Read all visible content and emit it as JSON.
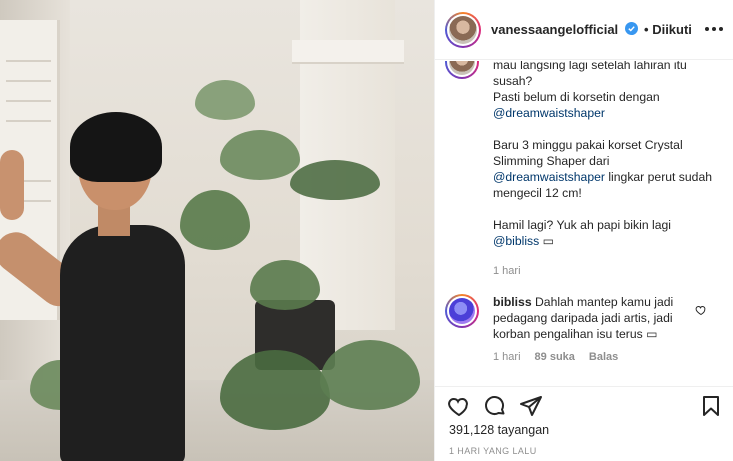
{
  "post": {
    "username": "vanessaangelofficial",
    "follow_separator": "•",
    "follow_status": "Diikuti",
    "caption": {
      "line1": "mau langsing lagi setelah lahiran itu susah?",
      "line2a": "Pasti belum di korsetin dengan",
      "mention1": "@dreamwaistshaper",
      "line3a": "Baru 3 minggu pakai korset Crystal Slimming Shaper dari",
      "mention2": "@dreamwaistshaper",
      "line3b": "lingkar perut sudah mengecil 12 cm!",
      "line4a": "Hamil lagi? Yuk ah papi bikin lagi",
      "mention3": "@bibliss",
      "emoji_placeholder": "▭",
      "time": "1 hari"
    },
    "comment": {
      "username": "bibliss",
      "text": "Dahlah mantep kamu jadi pedagang daripada jadi artis, jadi korban pengalihan isu terus",
      "emoji_placeholder": "▭",
      "time": "1 hari",
      "likes": "89 suka",
      "reply_label": "Balas"
    },
    "views": "391,128 tayangan",
    "date": "1 HARI YANG LALU"
  },
  "colors": {
    "verified": "#3897f0",
    "mention": "#00376b",
    "muted": "#8e8e8e",
    "text": "#262626"
  },
  "icons": [
    "verified-badge-icon",
    "more-options-icon",
    "heart-icon",
    "comment-icon",
    "share-icon",
    "bookmark-icon",
    "heart-small-icon"
  ]
}
